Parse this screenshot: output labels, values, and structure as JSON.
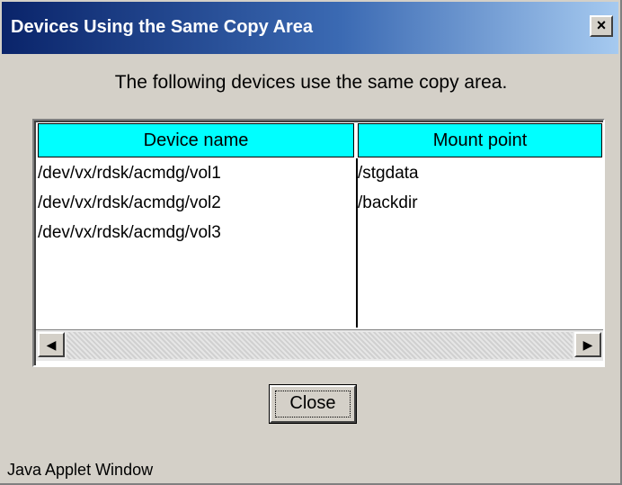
{
  "window": {
    "title": "Devices Using the Same Copy Area",
    "close_glyph": "×"
  },
  "message": "The following devices use the same copy area.",
  "table": {
    "columns": [
      "Device name",
      "Mount point"
    ],
    "rows": [
      [
        "/dev/vx/rdsk/acmdg/vol1",
        "/stgdata"
      ],
      [
        "/dev/vx/rdsk/acmdg/vol2",
        "/backdir"
      ],
      [
        "/dev/vx/rdsk/acmdg/vol3",
        ""
      ]
    ]
  },
  "scrollbar": {
    "left_arrow": "◀",
    "right_arrow": "▶"
  },
  "buttons": {
    "close": "Close"
  },
  "status": "Java Applet Window",
  "colors": {
    "header_bg": "#00ffff",
    "titlebar_start": "#0a246a",
    "titlebar_end": "#a6caf0",
    "window_bg": "#d4d0c8"
  }
}
